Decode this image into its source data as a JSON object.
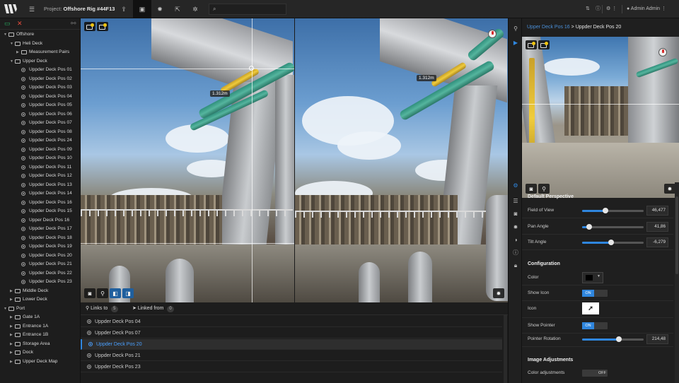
{
  "topbar": {
    "project_label": "Project:",
    "project_name": "Offshore Rig #44F13",
    "search_placeholder": "",
    "user_name": "Admin Admin"
  },
  "tree": [
    {
      "label": "Offshore",
      "kind": "folder",
      "level": 0,
      "expanded": true
    },
    {
      "label": "Heli Deck",
      "kind": "folder",
      "level": 1,
      "expanded": true
    },
    {
      "label": "Measurement Pairs",
      "kind": "folder",
      "level": 2,
      "expanded": false
    },
    {
      "label": "Upper Deck",
      "kind": "folder",
      "level": 1,
      "expanded": true
    },
    {
      "label": "Uppder Deck Pos 01",
      "kind": "pos",
      "level": 2
    },
    {
      "label": "Uppder Deck Pos 02",
      "kind": "pos",
      "level": 2
    },
    {
      "label": "Uppder Deck Pos 03",
      "kind": "pos",
      "level": 2
    },
    {
      "label": "Uppder Deck Pos 04",
      "kind": "pos",
      "level": 2
    },
    {
      "label": "Uppder Deck Pos 05",
      "kind": "pos",
      "level": 2
    },
    {
      "label": "Uppder Deck Pos 06",
      "kind": "pos",
      "level": 2
    },
    {
      "label": "Uppder Deck Pos 07",
      "kind": "pos",
      "level": 2
    },
    {
      "label": "Uppder Deck Pos 08",
      "kind": "pos",
      "level": 2
    },
    {
      "label": "Uppder Deck Pos 24",
      "kind": "pos",
      "level": 2
    },
    {
      "label": "Uppder Deck Pos 09",
      "kind": "pos",
      "level": 2
    },
    {
      "label": "Uppder Deck Pos 10",
      "kind": "pos",
      "level": 2
    },
    {
      "label": "Uppder Deck Pos 11",
      "kind": "pos",
      "level": 2
    },
    {
      "label": "Uppder Deck Pos 12",
      "kind": "pos",
      "level": 2
    },
    {
      "label": "Uppder Deck Pos 13",
      "kind": "pos",
      "level": 2
    },
    {
      "label": "Uppder Deck Pos 14",
      "kind": "pos",
      "level": 2
    },
    {
      "label": "Uppder Deck Pos 16",
      "kind": "pos",
      "level": 2
    },
    {
      "label": "Uppder Deck Pos 15",
      "kind": "pos",
      "level": 2
    },
    {
      "label": "Upper Deck Pos 16",
      "kind": "pos",
      "level": 2
    },
    {
      "label": "Uppder Deck Pos 17",
      "kind": "pos",
      "level": 2
    },
    {
      "label": "Uppder Deck Pos 18",
      "kind": "pos",
      "level": 2
    },
    {
      "label": "Uppder Deck Pos 19",
      "kind": "pos",
      "level": 2
    },
    {
      "label": "Uppder Deck Pos 20",
      "kind": "pos",
      "level": 2
    },
    {
      "label": "Uppder Deck Pos 21",
      "kind": "pos",
      "level": 2
    },
    {
      "label": "Uppder Deck Pos 22",
      "kind": "pos",
      "level": 2
    },
    {
      "label": "Uppder Deck Pos 23",
      "kind": "pos",
      "level": 2
    },
    {
      "label": "Middle Deck",
      "kind": "folder",
      "level": 1,
      "expanded": false
    },
    {
      "label": "Lower Deck",
      "kind": "folder",
      "level": 1,
      "expanded": false
    },
    {
      "label": "Port",
      "kind": "folder",
      "level": 0,
      "expanded": true
    },
    {
      "label": "Gate 1A",
      "kind": "folder",
      "level": 1,
      "expanded": false
    },
    {
      "label": "Entrance 1A",
      "kind": "folder",
      "level": 1,
      "expanded": false
    },
    {
      "label": "Entrance 1B",
      "kind": "folder",
      "level": 1,
      "expanded": false
    },
    {
      "label": "Storage Area",
      "kind": "folder",
      "level": 1,
      "expanded": false
    },
    {
      "label": "Dock",
      "kind": "folder",
      "level": 1,
      "expanded": false
    },
    {
      "label": "Upper Deck Map",
      "kind": "folder",
      "level": 1,
      "expanded": false
    }
  ],
  "viewer": {
    "measurement": "1.312m"
  },
  "links": {
    "links_to_label": "Links to",
    "links_to_count": "5",
    "linked_from_label": "Linked from",
    "linked_from_count": "0",
    "items": [
      {
        "label": "Uppder Deck Pos 04",
        "selected": false
      },
      {
        "label": "Uppder Deck Pos 07",
        "selected": false
      },
      {
        "label": "Uppder Deck Pos 20",
        "selected": true
      },
      {
        "label": "Uppder Deck Pos 21",
        "selected": false
      },
      {
        "label": "Uppder Deck Pos 23",
        "selected": false
      }
    ]
  },
  "panel": {
    "crumb_prev": "Upper Deck Pos 16",
    "crumb_sep": " > ",
    "crumb_current": "Uppder Deck Pos 20",
    "default_perspective_title": "Default Perspective",
    "fov_label": "Field of View",
    "fov_value": "46,477",
    "fov_fraction": 0.38,
    "pan_label": "Pan Angle",
    "pan_value": "41,86",
    "pan_fraction": 0.12,
    "tilt_label": "Tilt Angle",
    "tilt_value": "-6,279",
    "tilt_fraction": 0.47,
    "configuration_title": "Configuration",
    "color_label": "Color",
    "color_value": "#000000",
    "show_icon_label": "Show Icon",
    "show_icon_state": "ON",
    "icon_label": "Icon",
    "show_pointer_label": "Show Pointer",
    "show_pointer_state": "ON",
    "pointer_rotation_label": "Pointer Rotation",
    "pointer_rotation_value": "214,48",
    "pointer_rotation_fraction": 0.6,
    "image_adjustments_title": "Image Adjustments",
    "color_adjustments_label": "Color adjustments",
    "color_adjustments_state": "OFF"
  },
  "colors": {
    "accent": "#2f86de",
    "selected_text": "#4aa0ff",
    "delete": "#e74c3c",
    "add": "#27ae60"
  }
}
